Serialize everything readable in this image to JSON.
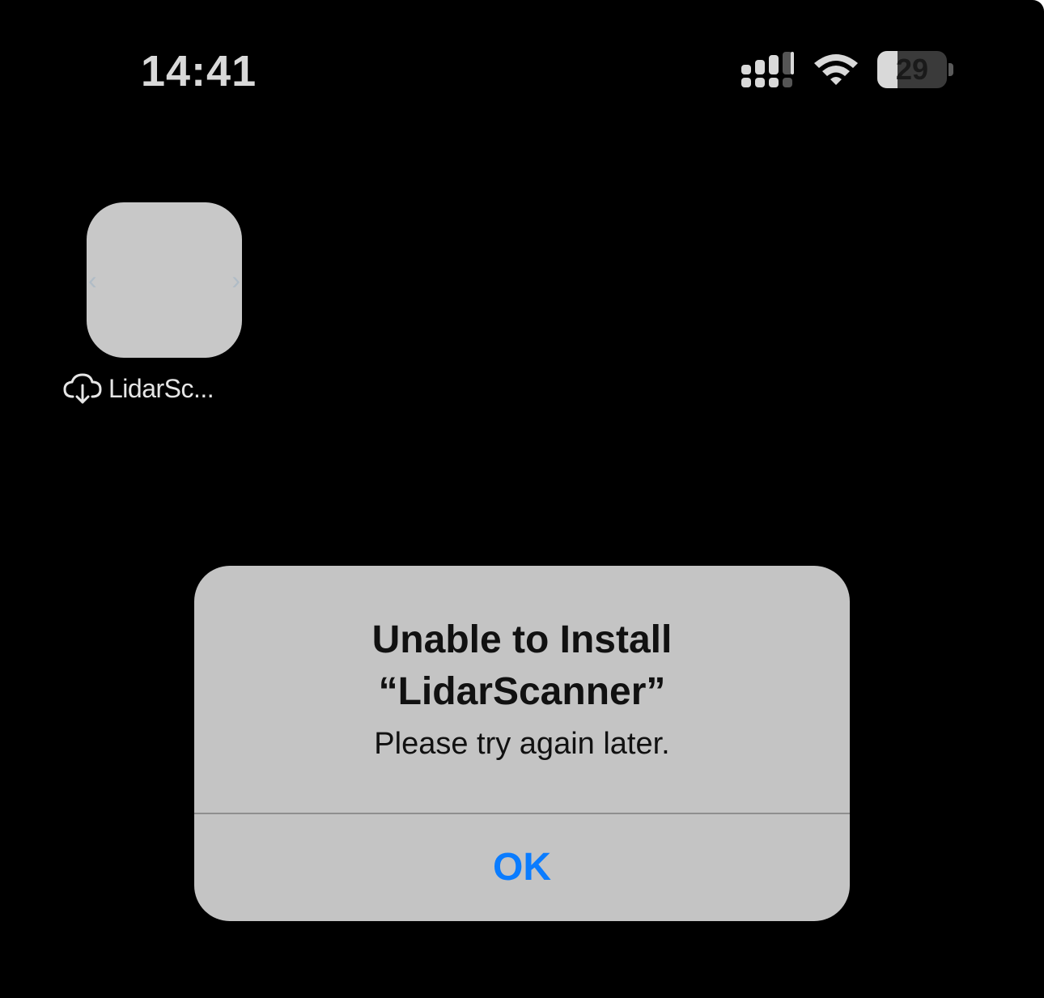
{
  "status_bar": {
    "time": "14:41",
    "battery_level": "29",
    "battery_fraction": 0.29,
    "icons": [
      "signal-icon",
      "wifi-icon",
      "battery-icon"
    ]
  },
  "home_screen": {
    "app": {
      "label": "LidarSc...",
      "status_icon": "cloud-download-icon"
    }
  },
  "alert": {
    "title": "Unable to Install\n“LidarScanner”",
    "message": "Please try again later.",
    "ok_label": "OK",
    "ok_color": "#0a7cff"
  }
}
